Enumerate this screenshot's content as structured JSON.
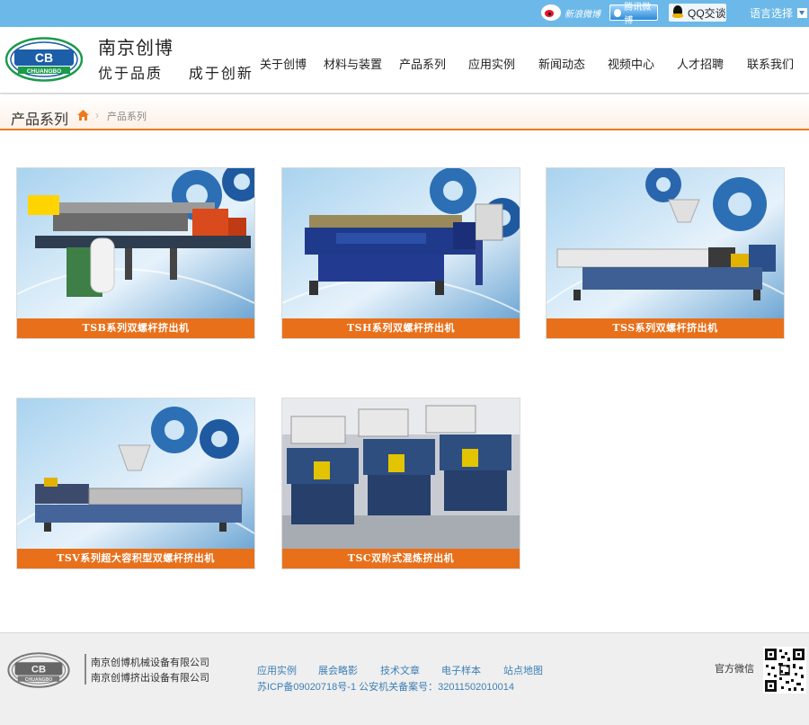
{
  "topbar": {
    "weibo_label": "新浪微博",
    "tencent_label": "腾讯微博",
    "qq_label": "QQ交谈",
    "language_label": "语言选择"
  },
  "header": {
    "brand_name": "南京创博",
    "slogan": "优于品质  成于创新",
    "logo_text": "CHUANGBO",
    "nav": [
      "关于创博",
      "材料与装置",
      "产品系列",
      "应用实例",
      "新闻动态",
      "视频中心",
      "人才招聘",
      "联系我们"
    ]
  },
  "breadcrumb": {
    "title": "产品系列",
    "separator": "›",
    "current": "产品系列"
  },
  "products": [
    {
      "caption": "TSB系列双螺杆挤出机"
    },
    {
      "caption": "TSH系列双螺杆挤出机"
    },
    {
      "caption": "TSS系列双螺杆挤出机"
    },
    {
      "caption": "TSV系列超大容积型双螺杆挤出机"
    },
    {
      "caption": "TSC双阶式混炼挤出机"
    }
  ],
  "footer": {
    "companies": [
      "南京创博机械设备有限公司",
      "南京创博挤出设备有限公司"
    ],
    "links": [
      "应用实例",
      "展会略影",
      "技术文章",
      "电子样本",
      "站点地图"
    ],
    "icp": "苏ICP备09020718号-1 公安机关备案号：32011502010014",
    "wechat_label": "官方微信"
  },
  "colors": {
    "topbar": "#6cb9e9",
    "accent": "#e8701b",
    "link": "#3d7fb5",
    "logo_green": "#1a9a4a",
    "logo_blue": "#1d5ea8"
  }
}
